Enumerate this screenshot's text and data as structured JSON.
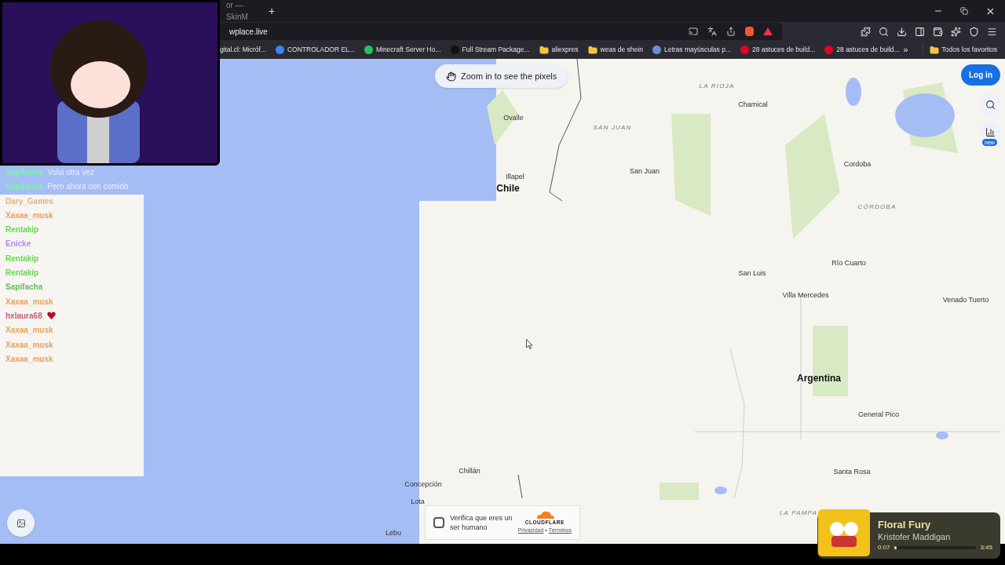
{
  "browser": {
    "tab": {
      "title": "or — SkinM"
    },
    "new_tab": "+",
    "address": "wplace.live",
    "bookmarks": [
      {
        "label": "igital.cl: Micróf...",
        "kind": "cut"
      },
      {
        "label": "CONTROLADOR EL...",
        "kind": "site",
        "color": "#3b82f6"
      },
      {
        "label": "Minecraft Server Ho...",
        "kind": "site",
        "color": "#22c55e"
      },
      {
        "label": "Full Stream Package...",
        "kind": "site",
        "color": "#111111"
      },
      {
        "label": "aliexpres",
        "kind": "folder"
      },
      {
        "label": "weas de shein",
        "kind": "folder"
      },
      {
        "label": "Letras mayúsculas p...",
        "kind": "site",
        "color": "#6b8fd6"
      },
      {
        "label": "28 astuces de build...",
        "kind": "pin"
      },
      {
        "label": "28 astuces de build...",
        "kind": "pin"
      }
    ],
    "more": "»",
    "all_bookmarks": "Todos los favoritos"
  },
  "map": {
    "hint": "Zoom in to see the pixels",
    "login": "Log in",
    "badge": "new",
    "labels": [
      {
        "text": "LA RIOJA",
        "kind": "region"
      },
      {
        "text": "Chamical",
        "kind": "city"
      },
      {
        "text": "Ovalle",
        "kind": "city"
      },
      {
        "text": "SAN JUAN",
        "kind": "region"
      },
      {
        "text": "San Juan",
        "kind": "city"
      },
      {
        "text": "Cordoba",
        "kind": "city"
      },
      {
        "text": "Illapel",
        "kind": "city"
      },
      {
        "text": "Chile",
        "kind": "country"
      },
      {
        "text": "CÓRDOBA",
        "kind": "region"
      },
      {
        "text": "Río Cuarto",
        "kind": "city"
      },
      {
        "text": "San Luis",
        "kind": "city"
      },
      {
        "text": "Villa Mercedes",
        "kind": "city"
      },
      {
        "text": "Venado Tuerto",
        "kind": "city"
      },
      {
        "text": "Argentina",
        "kind": "country"
      },
      {
        "text": "General Pico",
        "kind": "city"
      },
      {
        "text": "Santa Rosa",
        "kind": "city"
      },
      {
        "text": "Chillán",
        "kind": "city"
      },
      {
        "text": "Concepción",
        "kind": "city"
      },
      {
        "text": "Lota",
        "kind": "city"
      },
      {
        "text": "LA PAMPA",
        "kind": "region"
      },
      {
        "text": "Lebu",
        "kind": "city"
      }
    ]
  },
  "captcha": {
    "checked": false,
    "text": "Verifica que eres un ser humano",
    "brand": "CLOUDFLARE",
    "links": [
      "Privacidad",
      "Términos"
    ],
    "separator": "•"
  },
  "chat": [
    {
      "user": "Sapifacha",
      "color": "#86efac",
      "message": "Volvi otra vez",
      "heart": false
    },
    {
      "user": "Sapifacha",
      "color": "#86efac",
      "message": "Pero ahora con comida",
      "heart": false
    },
    {
      "user": "Dary_Games",
      "color": "#e0b87a",
      "heart": false
    },
    {
      "user": "Xaxaa_musk",
      "color": "#e8a25a",
      "heart": false
    },
    {
      "user": "Rentakip",
      "color": "#6ad655",
      "heart": false
    },
    {
      "user": "Enicke",
      "color": "#b98ae8",
      "heart": false
    },
    {
      "user": "Rentakip",
      "color": "#6ad655",
      "heart": false
    },
    {
      "user": "Rentakip",
      "color": "#6ad655",
      "heart": false
    },
    {
      "user": "Sapifacha",
      "color": "#5fbf5a",
      "heart": false
    },
    {
      "user": "Xaxaa_musk",
      "color": "#e8a25a",
      "heart": false
    },
    {
      "user": "hxlaura68",
      "color": "#c0607a",
      "heart": true
    },
    {
      "user": "Xaxaa_musk",
      "color": "#e8a25a",
      "heart": false
    },
    {
      "user": "Xaxaa_musk",
      "color": "#e8a25a",
      "heart": false
    },
    {
      "user": "Xaxaa_musk",
      "color": "#e8a25a",
      "heart": false
    }
  ],
  "player": {
    "title": "Floral Fury",
    "artist": "Kristofer Maddigan",
    "elapsed": "0:07",
    "level": 0.03,
    "total": "3:45"
  }
}
